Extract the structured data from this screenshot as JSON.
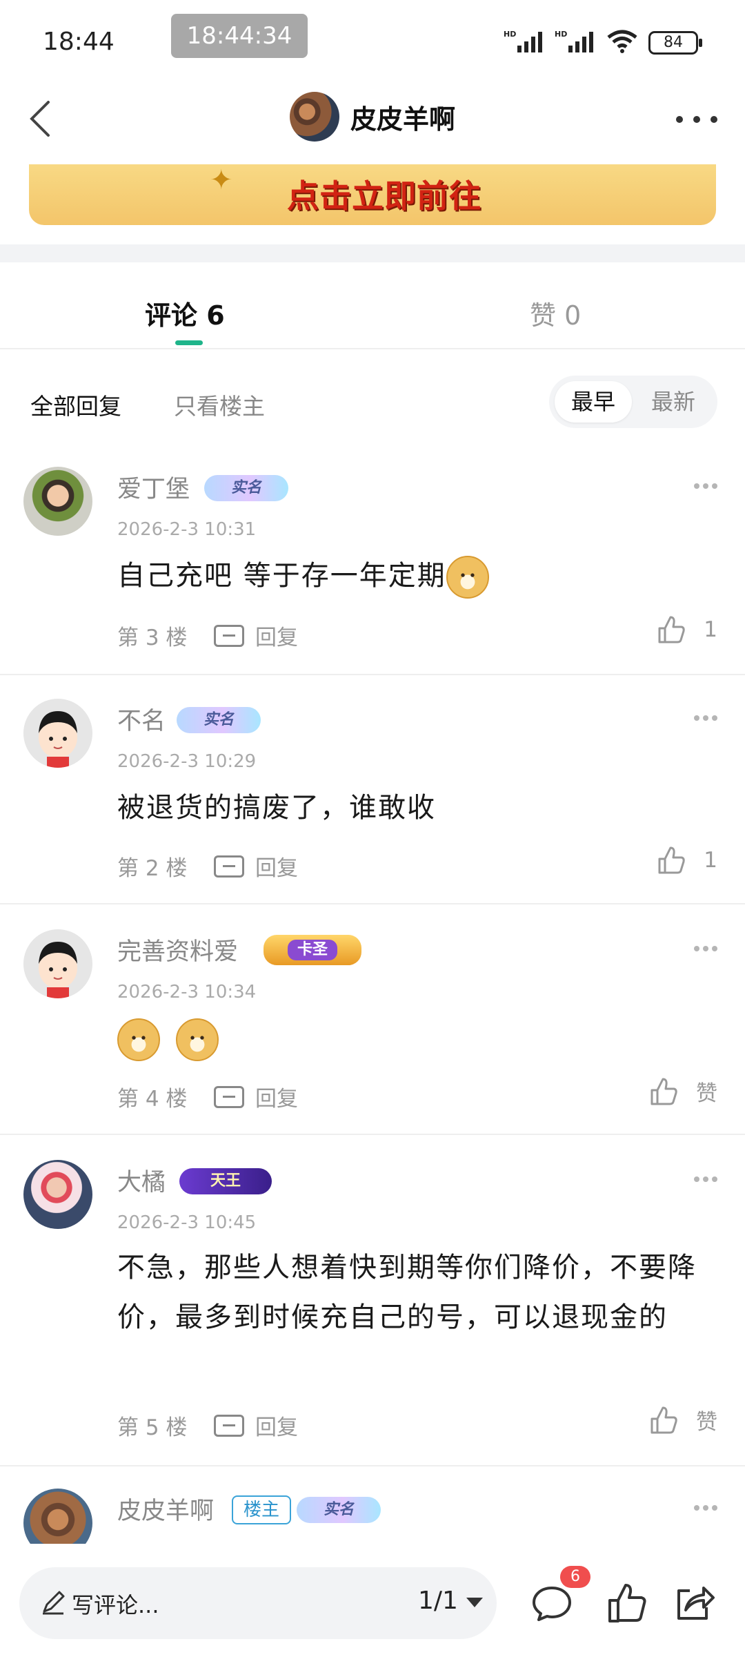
{
  "status_bar": {
    "time": "18:44",
    "clock_pill": "18:44:34",
    "network_1": "HD",
    "network_2": "HD",
    "battery": "84"
  },
  "header": {
    "title": "皮皮羊啊"
  },
  "banner": {
    "text": "点击立即前往"
  },
  "tabs": [
    {
      "label": "评论 6",
      "active": true
    },
    {
      "label": "赞 0",
      "active": false
    }
  ],
  "filters": {
    "all": "全部回复",
    "host_only": "只看楼主",
    "sort_earliest": "最早",
    "sort_newest": "最新"
  },
  "comments": [
    {
      "user": "爱丁堡",
      "badge": "实名",
      "time": "2026-2-3 10:31",
      "text": "自己充吧 等于存一年定期",
      "emojis": 1,
      "floor": "第 3 楼",
      "reply": "回复",
      "likes": "1"
    },
    {
      "user": "不名",
      "badge": "实名",
      "time": "2026-2-3 10:29",
      "text": "被退货的搞废了，谁敢收",
      "floor": "第 2 楼",
      "reply": "回复",
      "likes": "1"
    },
    {
      "user": "完善资料爱",
      "badge": "卡圣",
      "time": "2026-2-3 10:34",
      "text": "",
      "emojis": 2,
      "floor": "第 4 楼",
      "reply": "回复",
      "likes": "赞"
    },
    {
      "user": "大橘",
      "badge": "天王",
      "time": "2026-2-3 10:45",
      "text": "不急，那些人想着快到期等你们降价，不要降价，最多到时候充自己的号，可以退现金的",
      "floor": "第 5 楼",
      "reply": "回复",
      "likes": "赞"
    },
    {
      "user": "皮皮羊啊",
      "host_badge": "楼主",
      "badge": "实名"
    }
  ],
  "bottom_bar": {
    "placeholder": "写评论...",
    "page": "1/1",
    "comment_count": "6"
  },
  "colors": {
    "accent": "#1fb48a",
    "banner_text": "#d22313",
    "badge_red": "#f04e4e"
  }
}
